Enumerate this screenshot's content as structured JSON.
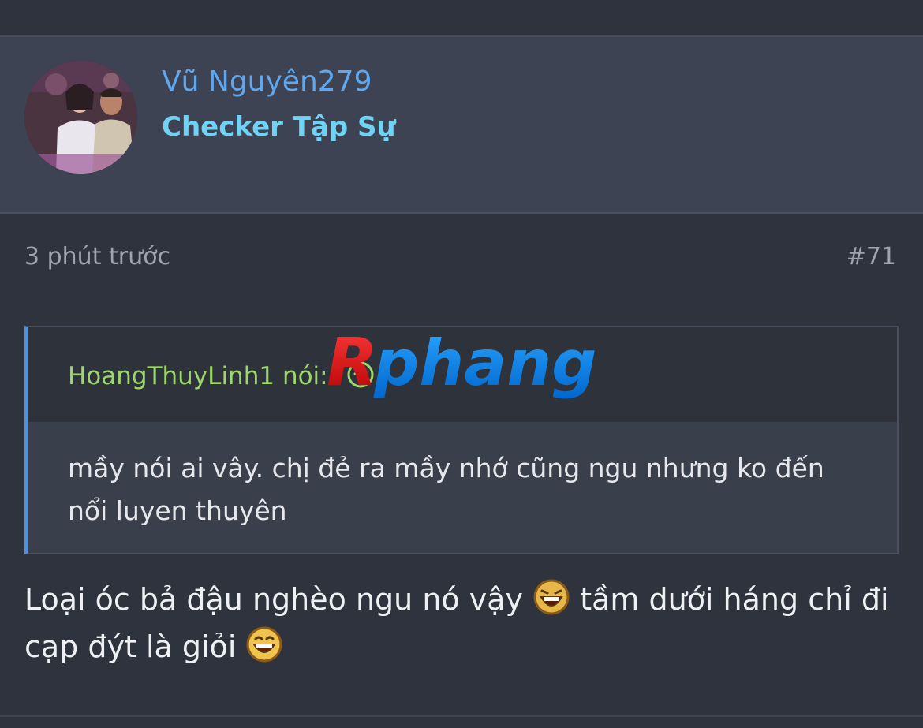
{
  "user": {
    "name": "Vũ Nguyên279",
    "title": "Checker Tập Sự"
  },
  "post": {
    "time": "3 phút trước",
    "number": "#71"
  },
  "quote": {
    "author": "HoangThuyLinh1",
    "said": "nói:",
    "text": "mầy nói ai vây. chị đẻ ra mầy nhớ cũng ngu nhưng ko đến nổi luyen thuyên"
  },
  "message": {
    "part1": "Loại óc bả đậu nghèo ngu nó vậy",
    "part2": "tầm dưới háng chỉ đi cạp đýt là giỏi"
  },
  "watermark": {
    "text": "Rphang"
  },
  "colors": {
    "username": "#5fa8f0",
    "user_title": "#6fd3f5",
    "quote_author": "#9dd66a",
    "quote_border": "#4b93e0"
  },
  "icons": {
    "avatar": "user-avatar-photo",
    "jump": "arrow-up-circle-icon",
    "emoji": "laughing-emoji-icon"
  }
}
